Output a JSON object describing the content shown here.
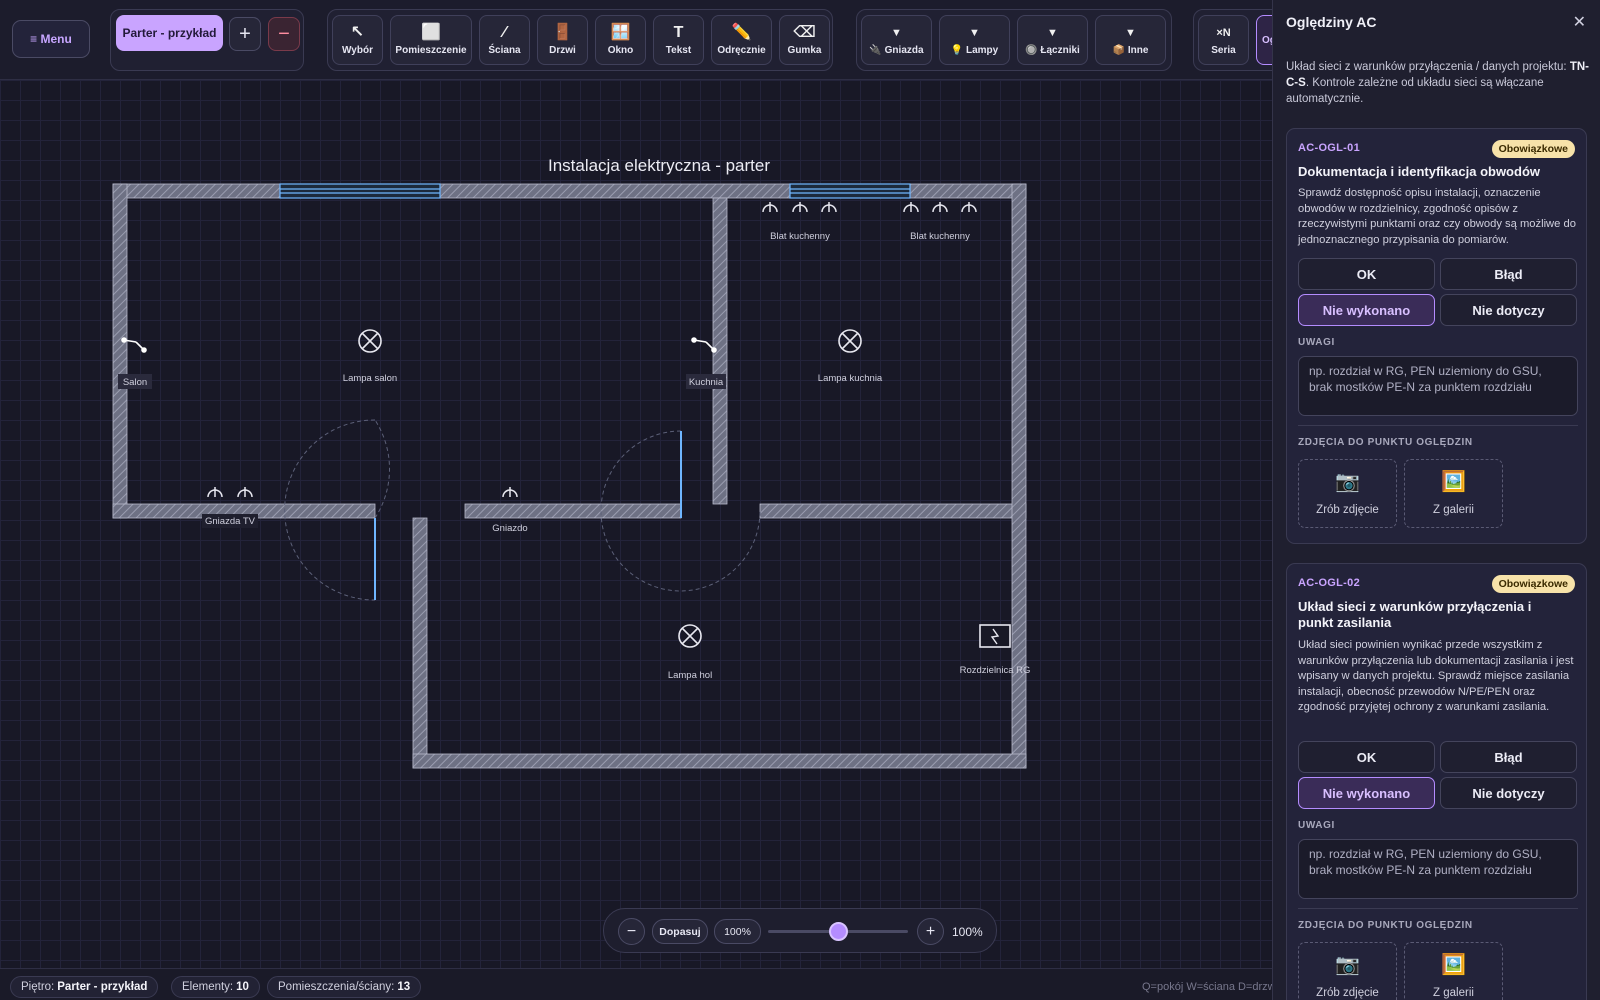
{
  "topbar": {
    "menu": "≡ Menu",
    "floor": "Parter - przykład",
    "floor_add": "+",
    "floor_del": "−",
    "tools": [
      {
        "label": "Wybór",
        "icon": "↖"
      },
      {
        "label": "Pomieszczenie",
        "icon": "⬜"
      },
      {
        "label": "Ściana",
        "icon": "⁄"
      },
      {
        "label": "Drzwi",
        "icon": "🚪"
      },
      {
        "label": "Okno",
        "icon": "🪟"
      },
      {
        "label": "Tekst",
        "icon": "T"
      },
      {
        "label": "Odręcznie",
        "icon": "✏️"
      },
      {
        "label": "Gumka",
        "icon": "⌫"
      }
    ],
    "elements": [
      {
        "label": "Gniazda",
        "icon": "🔌"
      },
      {
        "label": "Lampy",
        "icon": "💡"
      },
      {
        "label": "Łączniki",
        "icon": "🔘"
      },
      {
        "label": "Inne",
        "icon": "📦"
      }
    ],
    "dropdown_icon": "▼",
    "series": {
      "label": "Seria",
      "icon": "×N"
    },
    "cut_tab": "Og"
  },
  "plan": {
    "title": "Instalacja elektryczna - parter",
    "labels": {
      "salon": "Salon",
      "kuchnia": "Kuchnia",
      "lampa_salon": "Lampa salon",
      "lampa_kuchnia": "Lampa kuchnia",
      "lampa_hol": "Lampa hol",
      "gniazda_tv": "Gniazda TV",
      "gniazdo": "Gniazdo",
      "blat1": "Blat kuchenny",
      "blat2": "Blat kuchenny",
      "rozdzielnica": "Rozdzielnica RG"
    }
  },
  "zoom": {
    "minus": "−",
    "fit": "Dopasuj",
    "value": "100%",
    "plus": "+",
    "readout": "100%",
    "level_fraction": 0.5
  },
  "status": {
    "floor_label": "Piętro:",
    "floor_value": "Parter - przykład",
    "elements_label": "Elementy:",
    "elements_value": "10",
    "rooms_label": "Pomieszczenia/ściany:",
    "rooms_value": "13",
    "hint": "Q=pokój W=ściana D=drzwi"
  },
  "panel": {
    "title": "Oględziny AC",
    "close": "✕",
    "info_pre": "Układ sieci z warunków przyłączenia / danych projektu:",
    "info_bold": "TN-C-S",
    "info_post": ". Kontrole zależne od układu sieci są włączane automatycznie.",
    "cards": [
      {
        "code": "AC-OGL-01",
        "badge": "Obowiązkowe",
        "title": "Dokumentacja i identyfikacja obwodów",
        "desc": "Sprawdź dostępność opisu instalacji, oznaczenie obwodów w rozdzielnicy, zgodność opisów z rzeczywistymi punktami oraz czy obwody są możliwe do jednoznacznego przypisania do pomiarów.",
        "btn_ok": "OK",
        "btn_err": "Błąd",
        "btn_nw": "Nie wykonano",
        "btn_nd": "Nie dotyczy",
        "notes_label": "UWAGI",
        "notes_placeholder": "np. rozdział w RG, PEN uziemiony do GSU, brak mostków PE-N za punktem rozdziału",
        "photos_label": "ZDJĘCIA DO PUNKTU OGLĘDZIN",
        "photo_take": "Zrób zdjęcie",
        "photo_take_icon": "📷",
        "photo_gallery": "Z galerii",
        "photo_gallery_icon": "🖼️"
      },
      {
        "code": "AC-OGL-02",
        "badge": "Obowiązkowe",
        "title": "Układ sieci z warunków przyłączenia i punkt zasilania",
        "desc": "Układ sieci powinien wynikać przede wszystkim z warunków przyłączenia lub dokumentacji zasilania i jest wpisany w danych projektu. Sprawdź miejsce zasilania instalacji, obecność przewodów N/PE/PEN oraz zgodność przyjętej ochrony z warunkami zasilania.",
        "btn_ok": "OK",
        "btn_err": "Błąd",
        "btn_nw": "Nie wykonano",
        "btn_nd": "Nie dotyczy",
        "notes_label": "UWAGI",
        "notes_placeholder": "np. rozdział w RG, PEN uziemiony do GSU, brak mostków PE-N za punktem rozdziału",
        "photos_label": "ZDJĘCIA DO PUNKTU OGLĘDZIN",
        "photo_take": "Zrób zdjęcie",
        "photo_take_icon": "📷",
        "photo_gallery": "Z galerii",
        "photo_gallery_icon": "🖼️"
      }
    ]
  }
}
